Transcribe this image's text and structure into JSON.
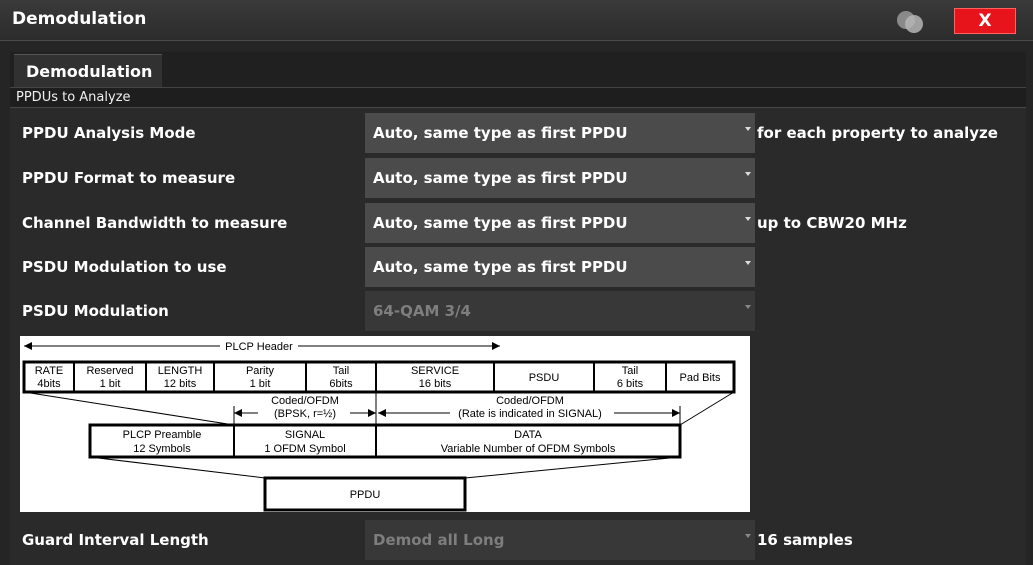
{
  "window": {
    "title": "Demodulation",
    "close_label": "X"
  },
  "tabs": [
    {
      "label": "Demodulation"
    }
  ],
  "section": {
    "label": "PPDUs to Analyze"
  },
  "rows": [
    {
      "label": "PPDU Analysis Mode",
      "value": "Auto, same type as first PPDU",
      "suffix": "for each property to analyze",
      "enabled": true
    },
    {
      "label": "PPDU Format to measure",
      "value": "Auto, same type as first PPDU",
      "suffix": "",
      "enabled": true
    },
    {
      "label": "Channel Bandwidth to measure",
      "value": "Auto, same type as first PPDU",
      "suffix": "up to CBW20 MHz",
      "enabled": true
    },
    {
      "label": "PSDU Modulation to use",
      "value": "Auto, same type as first PPDU",
      "suffix": "",
      "enabled": true
    },
    {
      "label": "PSDU Modulation",
      "value": "64-QAM 3/4",
      "suffix": "",
      "enabled": false
    },
    {
      "label": "Guard Interval Length",
      "value": "Demod all Long",
      "suffix": "16 samples",
      "enabled": false
    }
  ],
  "diagram": {
    "plcp_header": "PLCP Header",
    "fields": [
      {
        "l1": "RATE",
        "l2": "4bits"
      },
      {
        "l1": "Reserved",
        "l2": "1 bit"
      },
      {
        "l1": "LENGTH",
        "l2": "12 bits"
      },
      {
        "l1": "Parity",
        "l2": "1 bit"
      },
      {
        "l1": "Tail",
        "l2": "6bits"
      },
      {
        "l1": "SERVICE",
        "l2": "16 bits"
      },
      {
        "l1": "PSDU",
        "l2": ""
      },
      {
        "l1": "Tail",
        "l2": "6 bits"
      },
      {
        "l1": "Pad Bits",
        "l2": ""
      }
    ],
    "coded_signal": {
      "l1": "Coded/OFDM",
      "l2": "(BPSK, r=½)"
    },
    "coded_data": {
      "l1": "Coded/OFDM",
      "l2": "(Rate is indicated in SIGNAL)"
    },
    "preamble": {
      "l1": "PLCP Preamble",
      "l2": "12 Symbols"
    },
    "signal": {
      "l1": "SIGNAL",
      "l2": "1 OFDM Symbol"
    },
    "data": {
      "l1": "DATA",
      "l2": "Variable Number of OFDM Symbols"
    },
    "ppdu": "PPDU"
  },
  "colors": {
    "close": "#e8141b",
    "dropdown": "#4b4b4b",
    "background": "#2a2a2a"
  }
}
